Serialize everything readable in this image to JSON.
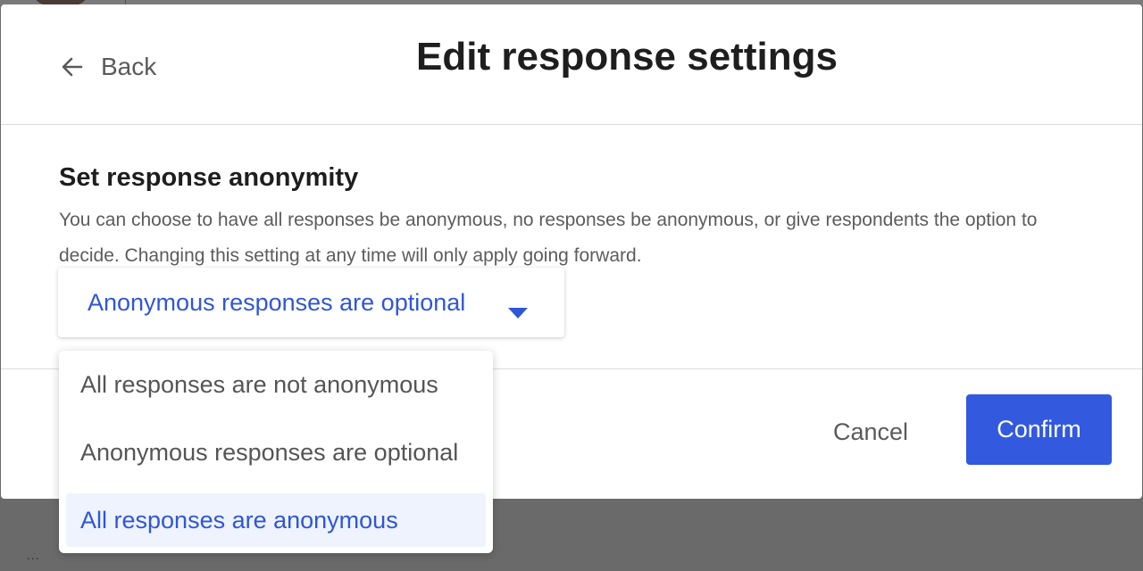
{
  "header": {
    "back_label": "Back",
    "title": "Edit response settings"
  },
  "section": {
    "title": "Set response anonymity",
    "description": "You can choose to have all responses be anonymous, no responses be anonymous, or give respondents the option to decide. Changing this setting at any time will only apply going forward."
  },
  "select": {
    "selected_value": "Anonymous responses are optional",
    "options": [
      "All responses are not anonymous",
      "Anonymous responses are optional",
      "All responses are anonymous"
    ],
    "highlighted_index": 2
  },
  "footer": {
    "cancel_label": "Cancel",
    "confirm_label": "Confirm"
  },
  "backdrop": {
    "ellipsis": "..."
  },
  "colors": {
    "accent": "#3259de",
    "link_text": "#2f56d8",
    "highlight_bg": "#eef3fd",
    "overlay": "#6a6a6a"
  },
  "icons": {
    "back": "arrow-left-icon",
    "caret": "caret-down-icon"
  }
}
